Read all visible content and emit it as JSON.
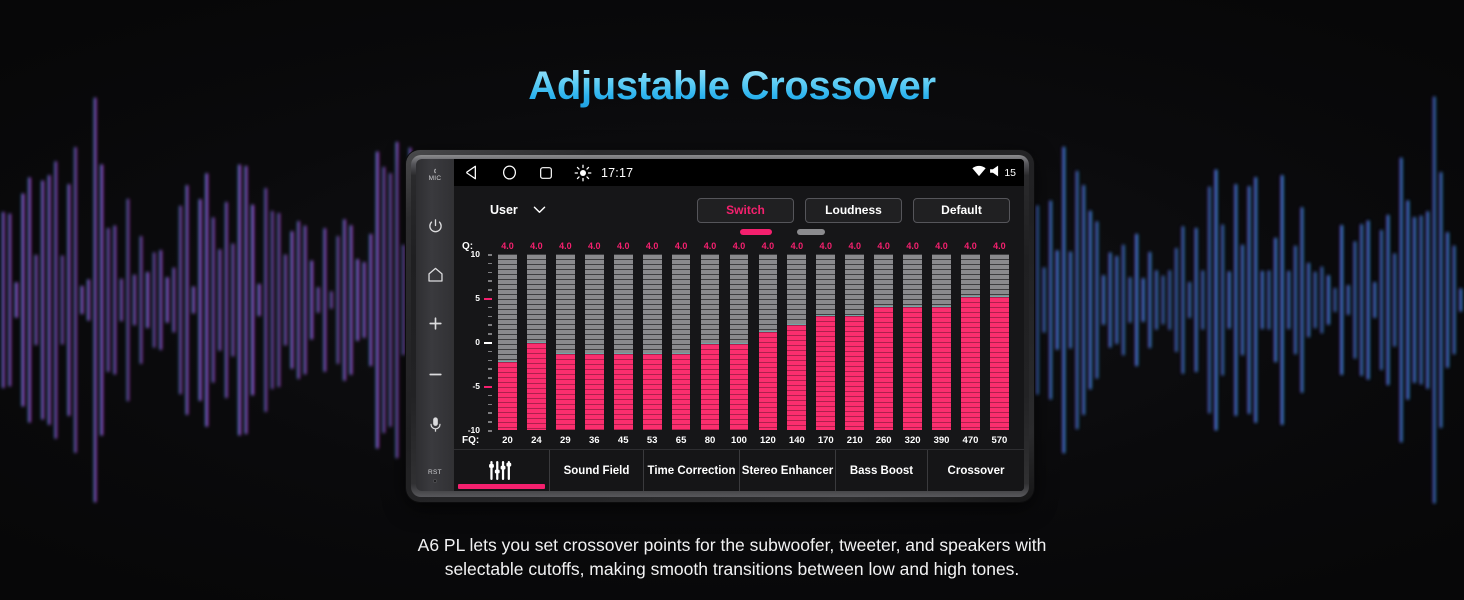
{
  "title": "Adjustable Crossover",
  "caption": {
    "line1": "A6 PL lets you set crossover points for the subwoofer, tweeter, and speakers with",
    "line2": "selectable cutoffs, making smooth transitions between low and high tones."
  },
  "colors": {
    "accent_pink": "#f4206e",
    "bar_fill": "#fb2e6e",
    "bar_track": "#8a8a8d",
    "title_cyan": "#5dcdf5",
    "screen_bg": "#161618",
    "wave_cyan": "#25d3e8",
    "wave_blue": "#3b63f0",
    "wave_purple": "#9b2bdf",
    "wave_magenta": "#e62bb0"
  },
  "device": {
    "hardware_keys": [
      {
        "name": "mic-indicator",
        "label": "MIC"
      },
      {
        "name": "power-button",
        "label": ""
      },
      {
        "name": "home-button",
        "label": ""
      },
      {
        "name": "volume-up-button",
        "label": ""
      },
      {
        "name": "volume-down-button",
        "label": ""
      },
      {
        "name": "microphone-button",
        "label": ""
      },
      {
        "name": "reset-button",
        "label": "RST"
      }
    ]
  },
  "statusbar": {
    "time": "17:17",
    "volume": "15",
    "nav_icons": [
      "back-icon",
      "home-icon",
      "recents-icon",
      "brightness-icon"
    ],
    "right_icons": [
      "wifi-icon",
      "volume-icon"
    ]
  },
  "controls": {
    "preset_label": "User",
    "preset_caret": "chevron-down-icon",
    "buttons": [
      {
        "label": "Switch",
        "active": true
      },
      {
        "label": "Loudness",
        "active": false
      },
      {
        "label": "Default",
        "active": false
      }
    ]
  },
  "chart_data": {
    "type": "bar",
    "title": "Equalizer",
    "xlabel": "FQ:",
    "ylabel": "Q:",
    "ylim": [
      -10,
      10
    ],
    "yticks": [
      10,
      5,
      0,
      -5,
      -10
    ],
    "ytick_labels": [
      "10",
      "5",
      "0",
      "-5",
      "-10"
    ],
    "categories": [
      "20",
      "24",
      "29",
      "36",
      "45",
      "53",
      "65",
      "80",
      "100",
      "120",
      "140",
      "170",
      "210",
      "260",
      "320",
      "390",
      "470",
      "570"
    ],
    "q_values": [
      "4.0",
      "4.0",
      "4.0",
      "4.0",
      "4.0",
      "4.0",
      "4.0",
      "4.0",
      "4.0",
      "4.0",
      "4.0",
      "4.0",
      "4.0",
      "4.0",
      "4.0",
      "4.0",
      "4.0",
      "4.0"
    ],
    "values": [
      -2.2,
      0.0,
      -1.2,
      -1.2,
      -1.2,
      -1.2,
      -1.2,
      -0.1,
      -0.1,
      1.2,
      2.1,
      3.1,
      3.1,
      4.1,
      4.1,
      4.1,
      5.2,
      5.2
    ],
    "grid": false,
    "legend": false
  },
  "tabs": [
    {
      "label": "",
      "icon": "equalizer-icon",
      "active": true,
      "name": "tab-equalizer"
    },
    {
      "label": "Sound Field",
      "icon": "",
      "active": false,
      "name": "tab-sound-field"
    },
    {
      "label": "Time Correction",
      "icon": "",
      "active": false,
      "name": "tab-time-correction"
    },
    {
      "label": "Stereo Enhancer",
      "icon": "",
      "active": false,
      "name": "tab-stereo-enhancer"
    },
    {
      "label": "Bass Boost",
      "icon": "",
      "active": false,
      "name": "tab-bass-boost"
    },
    {
      "label": "Crossover",
      "icon": "",
      "active": false,
      "name": "tab-crossover"
    }
  ]
}
